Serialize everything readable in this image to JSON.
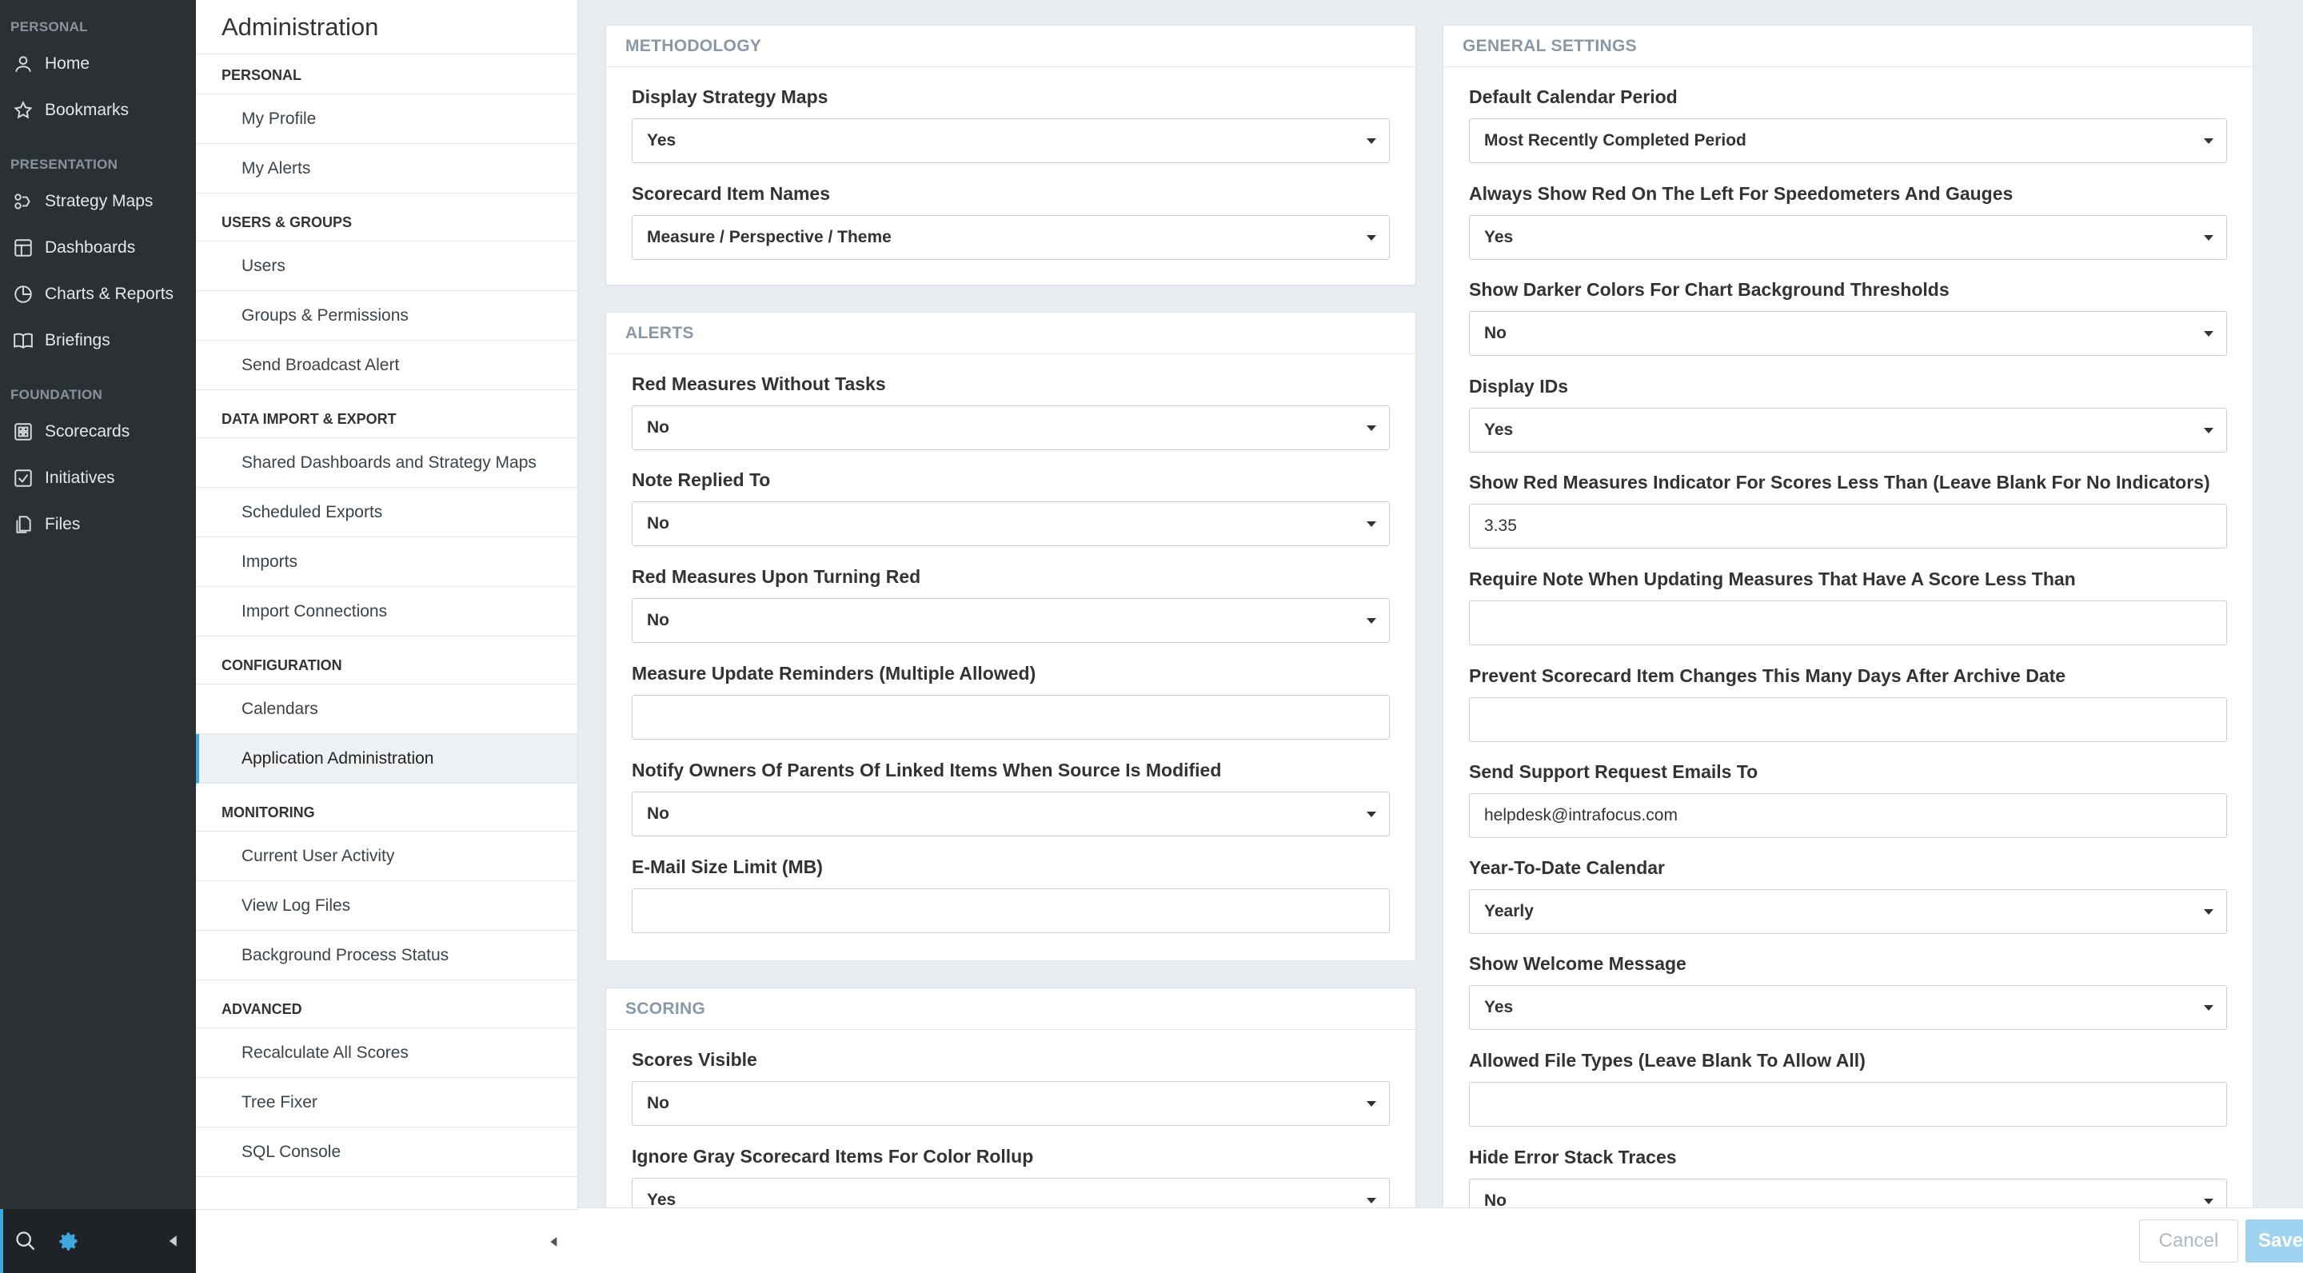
{
  "nav": {
    "sections": [
      {
        "label": "PERSONAL",
        "items": [
          {
            "label": "Home",
            "icon": "person-icon"
          },
          {
            "label": "Bookmarks",
            "icon": "star-icon"
          }
        ]
      },
      {
        "label": "PRESENTATION",
        "items": [
          {
            "label": "Strategy Maps",
            "icon": "strategy-map-icon"
          },
          {
            "label": "Dashboards",
            "icon": "dashboard-icon"
          },
          {
            "label": "Charts & Reports",
            "icon": "pie-chart-icon"
          },
          {
            "label": "Briefings",
            "icon": "book-icon"
          }
        ]
      },
      {
        "label": "FOUNDATION",
        "items": [
          {
            "label": "Scorecards",
            "icon": "scorecard-icon"
          },
          {
            "label": "Initiatives",
            "icon": "checkbox-icon"
          },
          {
            "label": "Files",
            "icon": "files-icon"
          }
        ]
      }
    ],
    "bottom_icons": [
      "search-icon",
      "gear-icon",
      "collapse-left-icon"
    ],
    "accent_color": "#3fa9dd"
  },
  "admin_menu": {
    "title": "Administration",
    "groups": [
      {
        "label": "PERSONAL",
        "items": [
          "My Profile",
          "My Alerts"
        ]
      },
      {
        "label": "USERS & GROUPS",
        "items": [
          "Users",
          "Groups & Permissions",
          "Send Broadcast Alert"
        ]
      },
      {
        "label": "DATA IMPORT & EXPORT",
        "items": [
          "Shared Dashboards and Strategy Maps",
          "Scheduled Exports",
          "Imports",
          "Import Connections"
        ]
      },
      {
        "label": "CONFIGURATION",
        "items": [
          "Calendars",
          "Application Administration"
        ]
      },
      {
        "label": "MONITORING",
        "items": [
          "Current User Activity",
          "View Log Files",
          "Background Process Status"
        ]
      },
      {
        "label": "ADVANCED",
        "items": [
          "Recalculate All Scores",
          "Tree Fixer",
          "SQL Console"
        ]
      }
    ],
    "active_item": "Application Administration"
  },
  "panels": {
    "methodology": {
      "title": "METHODOLOGY",
      "fields": [
        {
          "label": "Display Strategy Maps",
          "value": "Yes",
          "type": "select"
        },
        {
          "label": "Scorecard Item Names",
          "value": "Measure / Perspective / Theme",
          "type": "select"
        }
      ]
    },
    "alerts": {
      "title": "ALERTS",
      "fields": [
        {
          "label": "Red Measures Without Tasks",
          "value": "No",
          "type": "select"
        },
        {
          "label": "Note Replied To",
          "value": "No",
          "type": "select"
        },
        {
          "label": "Red Measures Upon Turning Red",
          "value": "No",
          "type": "select"
        },
        {
          "label": "Measure Update Reminders (Multiple Allowed)",
          "value": "",
          "type": "input"
        },
        {
          "label": "Notify Owners Of Parents Of Linked Items When Source Is Modified",
          "value": "No",
          "type": "select"
        },
        {
          "label": "E-Mail Size Limit (MB)",
          "value": "",
          "type": "input"
        }
      ]
    },
    "scoring": {
      "title": "SCORING",
      "fields": [
        {
          "label": "Scores Visible",
          "value": "No",
          "type": "select"
        },
        {
          "label": "Ignore Gray Scorecard Items For Color Rollup",
          "value": "Yes",
          "type": "select"
        }
      ]
    },
    "general": {
      "title": "GENERAL SETTINGS",
      "fields": [
        {
          "label": "Default Calendar Period",
          "value": "Most Recently Completed Period",
          "type": "select"
        },
        {
          "label": "Always Show Red On The Left For Speedometers And Gauges",
          "value": "Yes",
          "type": "select"
        },
        {
          "label": "Show Darker Colors For Chart Background Thresholds",
          "value": "No",
          "type": "select"
        },
        {
          "label": "Display IDs",
          "value": "Yes",
          "type": "select"
        },
        {
          "label": "Show Red Measures Indicator For Scores Less Than (Leave Blank For No Indicators)",
          "value": "3.35",
          "type": "input"
        },
        {
          "label": "Require Note When Updating Measures That Have A Score Less Than",
          "value": "",
          "type": "input"
        },
        {
          "label": "Prevent Scorecard Item Changes This Many Days After Archive Date",
          "value": "",
          "type": "input"
        },
        {
          "label": "Send Support Request Emails To",
          "value": "helpdesk@intrafocus.com",
          "type": "input"
        },
        {
          "label": "Year-To-Date Calendar",
          "value": "Yearly",
          "type": "select"
        },
        {
          "label": "Show Welcome Message",
          "value": "Yes",
          "type": "select"
        },
        {
          "label": "Allowed File Types (Leave Blank To Allow All)",
          "value": "",
          "type": "input"
        },
        {
          "label": "Hide Error Stack Traces",
          "value": "No",
          "type": "select"
        }
      ]
    }
  },
  "actions": {
    "cancel": "Cancel",
    "save": "Save"
  }
}
